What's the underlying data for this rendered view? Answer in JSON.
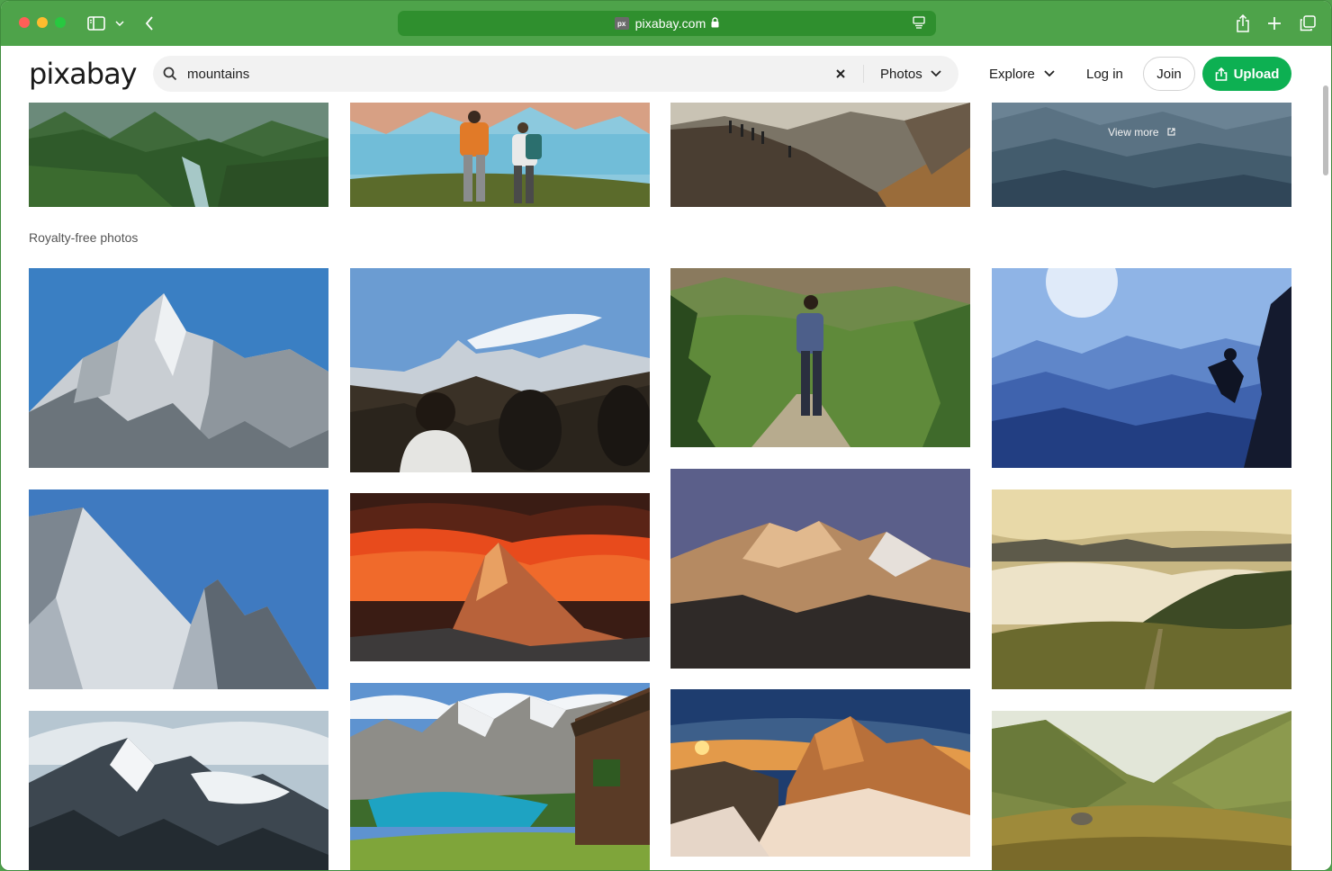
{
  "browser": {
    "url": "pixabay.com",
    "favicon_text": "px"
  },
  "header": {
    "logo": "pixabay",
    "search": {
      "value": "mountains",
      "placeholder": ""
    },
    "type_filter": "Photos",
    "explore_label": "Explore",
    "login_label": "Log in",
    "join_label": "Join",
    "upload_label": "Upload"
  },
  "content": {
    "view_more_label": "View more",
    "section_label": "Royalty-free photos"
  },
  "photos": [
    {
      "name": "green-valley-river"
    },
    {
      "name": "hikers-lake-view"
    },
    {
      "name": "hikers-ridge"
    },
    {
      "name": "misty-ranges"
    },
    {
      "name": "snowy-peak"
    },
    {
      "name": "people-viewing-peaks"
    },
    {
      "name": "hiker-trail"
    },
    {
      "name": "climber-silhouette"
    },
    {
      "name": "snowy-ridge-blue-sky"
    },
    {
      "name": "matterhorn-sunset"
    },
    {
      "name": "alpenglow-peaks"
    },
    {
      "name": "sea-of-fog"
    },
    {
      "name": "clouds-among-peaks"
    },
    {
      "name": "alpine-lake-cabin"
    },
    {
      "name": "sunrise-rocky-summit"
    },
    {
      "name": "green-alpine-valley"
    }
  ]
}
